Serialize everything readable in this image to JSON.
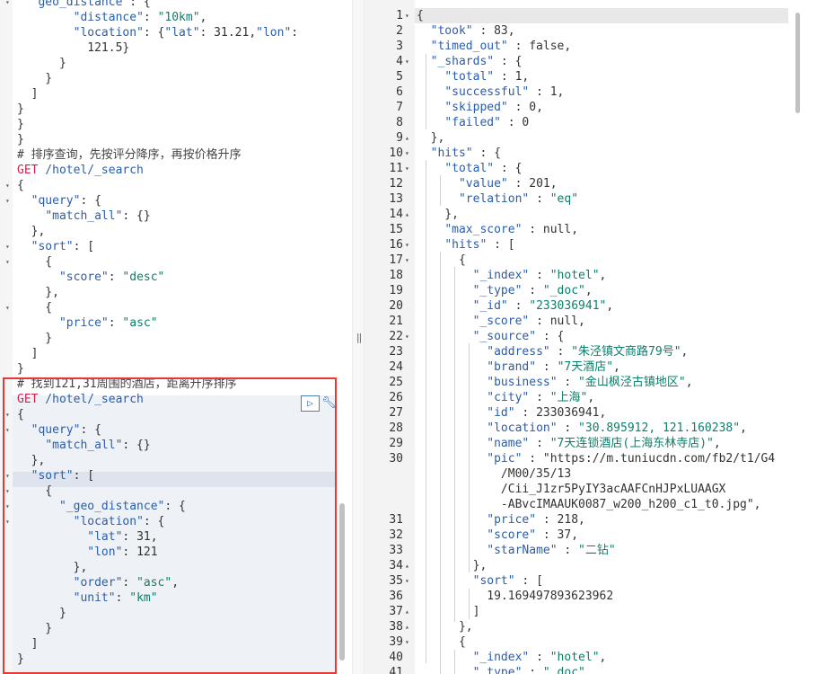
{
  "request_editor": {
    "lines": [
      {
        "text": "  \"geo_distance\": {"
      },
      {
        "text": "        \"distance\": \"10km\","
      },
      {
        "text": "        \"location\": {\"lat\": 31.21,\"lon\":"
      },
      {
        "text": "          121.5}"
      },
      {
        "text": "      }"
      },
      {
        "text": "    }"
      },
      {
        "text": "  ]"
      },
      {
        "text": "}"
      },
      {
        "text": "}"
      },
      {
        "text": "}"
      },
      {
        "text": "# 排序查询，先按评分降序，再按价格升序"
      },
      {
        "text": "GET /hotel/_search"
      },
      {
        "text": "{"
      },
      {
        "text": "  \"query\": {"
      },
      {
        "text": "    \"match_all\": {}"
      },
      {
        "text": "  },"
      },
      {
        "text": "  \"sort\": ["
      },
      {
        "text": "    {"
      },
      {
        "text": "      \"score\": \"desc\""
      },
      {
        "text": "    },"
      },
      {
        "text": "    {"
      },
      {
        "text": "      \"price\": \"asc\""
      },
      {
        "text": "    }"
      },
      {
        "text": "  ]"
      },
      {
        "text": "}"
      },
      {
        "text": "# 找到121,31周围的酒店，距离升序排序"
      },
      {
        "text": "GET /hotel/_search"
      },
      {
        "text": "{"
      },
      {
        "text": "  \"query\": {"
      },
      {
        "text": "    \"match_all\": {}"
      },
      {
        "text": "  },"
      },
      {
        "text": "  \"sort\": ["
      },
      {
        "text": "    {"
      },
      {
        "text": "      \"_geo_distance\": {"
      },
      {
        "text": "        \"location\": {"
      },
      {
        "text": "          \"lat\": 31,"
      },
      {
        "text": "          \"lon\": 121"
      },
      {
        "text": "        },"
      },
      {
        "text": "        \"order\": \"asc\","
      },
      {
        "text": "        \"unit\": \"km\""
      },
      {
        "text": "      }"
      },
      {
        "text": "    }"
      },
      {
        "text": "  ]"
      },
      {
        "text": "}"
      }
    ],
    "run_icon": "play-icon",
    "settings_icon": "wrench-icon"
  },
  "response_viewer": {
    "lines": [
      {
        "num": "1",
        "fold": true,
        "text": "{"
      },
      {
        "num": "2",
        "text": "  \"took\" : 83,"
      },
      {
        "num": "3",
        "text": "  \"timed_out\" : false,"
      },
      {
        "num": "4",
        "fold": true,
        "text": "  \"_shards\" : {"
      },
      {
        "num": "5",
        "text": "    \"total\" : 1,"
      },
      {
        "num": "6",
        "text": "    \"successful\" : 1,"
      },
      {
        "num": "7",
        "text": "    \"skipped\" : 0,"
      },
      {
        "num": "8",
        "text": "    \"failed\" : 0"
      },
      {
        "num": "9",
        "fold": true,
        "text": "  },"
      },
      {
        "num": "10",
        "fold": true,
        "text": "  \"hits\" : {"
      },
      {
        "num": "11",
        "fold": true,
        "text": "    \"total\" : {"
      },
      {
        "num": "12",
        "text": "      \"value\" : 201,"
      },
      {
        "num": "13",
        "text": "      \"relation\" : \"eq\""
      },
      {
        "num": "14",
        "fold": true,
        "text": "    },"
      },
      {
        "num": "15",
        "text": "    \"max_score\" : null,"
      },
      {
        "num": "16",
        "fold": true,
        "text": "    \"hits\" : ["
      },
      {
        "num": "17",
        "fold": true,
        "text": "      {"
      },
      {
        "num": "18",
        "text": "        \"_index\" : \"hotel\","
      },
      {
        "num": "19",
        "text": "        \"_type\" : \"_doc\","
      },
      {
        "num": "20",
        "text": "        \"_id\" : \"233036941\","
      },
      {
        "num": "21",
        "text": "        \"_score\" : null,"
      },
      {
        "num": "22",
        "fold": true,
        "text": "        \"_source\" : {"
      },
      {
        "num": "23",
        "text": "          \"address\" : \"朱泾镇文商路79号\","
      },
      {
        "num": "24",
        "text": "          \"brand\" : \"7天酒店\","
      },
      {
        "num": "25",
        "text": "          \"business\" : \"金山枫泾古镇地区\","
      },
      {
        "num": "26",
        "text": "          \"city\" : \"上海\","
      },
      {
        "num": "27",
        "text": "          \"id\" : 233036941,"
      },
      {
        "num": "28",
        "text": "          \"location\" : \"30.895912, 121.160238\","
      },
      {
        "num": "29",
        "text": "          \"name\" : \"7天连锁酒店(上海东林寺店)\","
      },
      {
        "num": "30",
        "text": "          \"pic\" : \"https://m.tuniucdn.com/fb2/t1/G4"
      },
      {
        "num": "",
        "text": "            /M00/35/13"
      },
      {
        "num": "",
        "text": "            /Cii_J1zr5PyIY3acAAFCnHJPxLUAAGX"
      },
      {
        "num": "",
        "text": "            -ABvcIMAAUK0087_w200_h200_c1_t0.jpg\","
      },
      {
        "num": "31",
        "text": "          \"price\" : 218,"
      },
      {
        "num": "32",
        "text": "          \"score\" : 37,"
      },
      {
        "num": "33",
        "text": "          \"starName\" : \"二钻\""
      },
      {
        "num": "34",
        "fold": true,
        "text": "        },"
      },
      {
        "num": "35",
        "fold": true,
        "text": "        \"sort\" : ["
      },
      {
        "num": "36",
        "text": "          19.169497893623962"
      },
      {
        "num": "37",
        "fold": true,
        "text": "        ]"
      },
      {
        "num": "38",
        "fold": true,
        "text": "      },"
      },
      {
        "num": "39",
        "fold": true,
        "text": "      {"
      },
      {
        "num": "40",
        "text": "        \"_index\" : \"hotel\","
      },
      {
        "num": "41",
        "text": "        \"_type\" : \"_doc\","
      }
    ]
  }
}
